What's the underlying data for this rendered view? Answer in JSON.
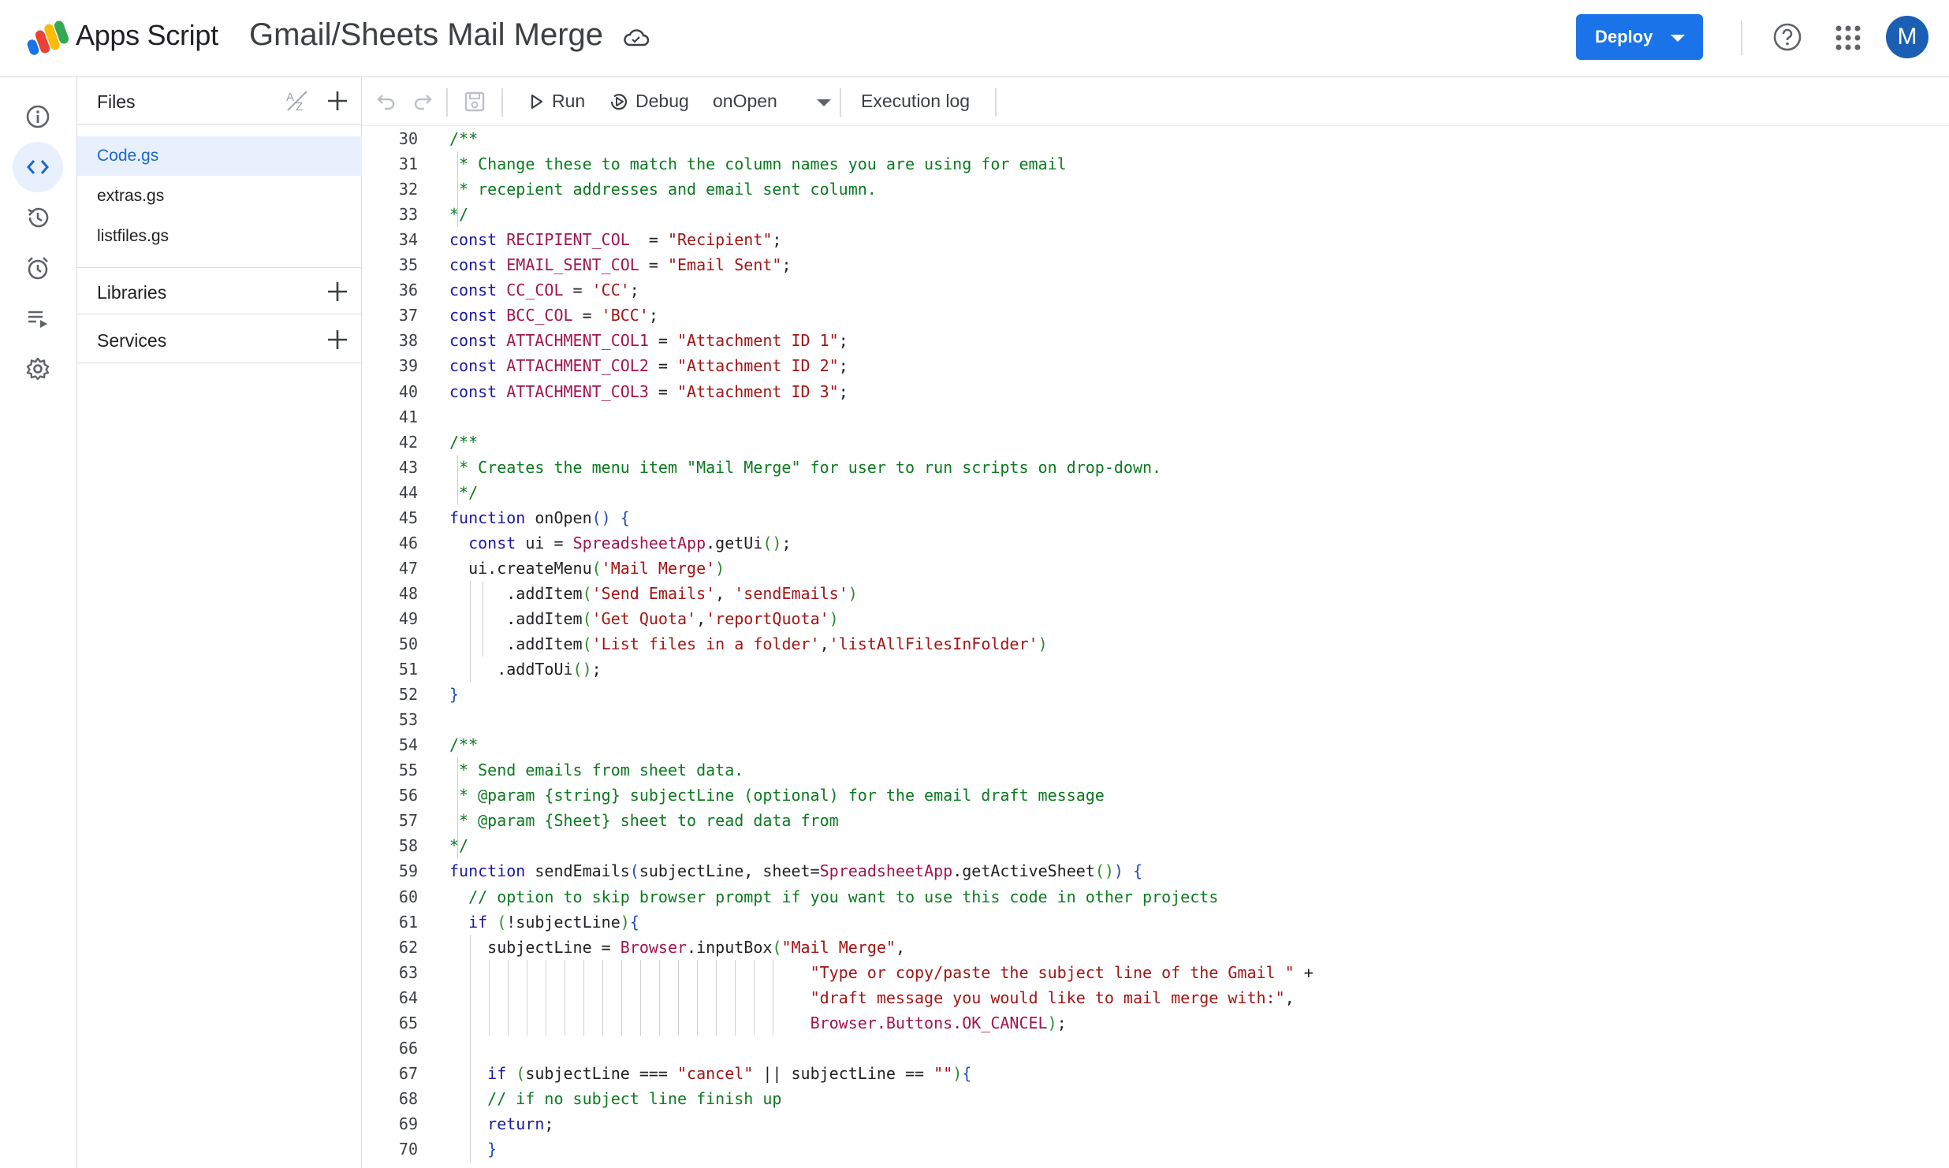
{
  "app": {
    "name": "Apps Script",
    "project_title": "Gmail/Sheets Mail Merge",
    "deploy_label": "Deploy",
    "avatar_letter": "M"
  },
  "rail": {
    "items": [
      {
        "name": "overview",
        "icon": "info-icon"
      },
      {
        "name": "editor",
        "icon": "code-icon",
        "active": true
      },
      {
        "name": "executions",
        "icon": "history-icon"
      },
      {
        "name": "triggers",
        "icon": "alarm-icon"
      },
      {
        "name": "executions-log",
        "icon": "list-play-icon"
      },
      {
        "name": "project-settings",
        "icon": "gear-icon"
      }
    ]
  },
  "files_panel": {
    "files_title": "Files",
    "files": [
      {
        "name": "Code.gs",
        "active": true
      },
      {
        "name": "extras.gs",
        "active": false
      },
      {
        "name": "listfiles.gs",
        "active": false
      }
    ],
    "libraries_title": "Libraries",
    "services_title": "Services"
  },
  "toolbar": {
    "run_label": "Run",
    "debug_label": "Debug",
    "function_selected": "onOpen",
    "execution_log_label": "Execution log"
  },
  "editor": {
    "lines": [
      {
        "n": "30",
        "tokens": [
          [
            "c",
            "/**"
          ]
        ]
      },
      {
        "n": "31",
        "tokens": [
          [
            "c",
            " * Change these to match the column names you are using for email"
          ]
        ]
      },
      {
        "n": "32",
        "tokens": [
          [
            "c",
            " * recepient addresses and email sent column."
          ]
        ]
      },
      {
        "n": "33",
        "tokens": [
          [
            "c",
            "*/"
          ]
        ]
      },
      {
        "n": "34",
        "tokens": [
          [
            "k",
            "const "
          ],
          [
            "v",
            "RECIPIENT_COL"
          ],
          [
            "p",
            "  = "
          ],
          [
            "s",
            "\"Recipient\""
          ],
          [
            "p",
            ";"
          ]
        ]
      },
      {
        "n": "35",
        "tokens": [
          [
            "k",
            "const "
          ],
          [
            "v",
            "EMAIL_SENT_COL"
          ],
          [
            "p",
            " = "
          ],
          [
            "s",
            "\"Email Sent\""
          ],
          [
            "p",
            ";"
          ]
        ]
      },
      {
        "n": "36",
        "tokens": [
          [
            "k",
            "const "
          ],
          [
            "v",
            "CC_COL"
          ],
          [
            "p",
            " = "
          ],
          [
            "s",
            "'CC'"
          ],
          [
            "p",
            ";"
          ]
        ]
      },
      {
        "n": "37",
        "tokens": [
          [
            "k",
            "const "
          ],
          [
            "v",
            "BCC_COL"
          ],
          [
            "p",
            " = "
          ],
          [
            "s",
            "'BCC'"
          ],
          [
            "p",
            ";"
          ]
        ]
      },
      {
        "n": "38",
        "tokens": [
          [
            "k",
            "const "
          ],
          [
            "v",
            "ATTACHMENT_COL1"
          ],
          [
            "p",
            " = "
          ],
          [
            "s",
            "\"Attachment ID 1\""
          ],
          [
            "p",
            ";"
          ]
        ]
      },
      {
        "n": "39",
        "tokens": [
          [
            "k",
            "const "
          ],
          [
            "v",
            "ATTACHMENT_COL2"
          ],
          [
            "p",
            " = "
          ],
          [
            "s",
            "\"Attachment ID 2\""
          ],
          [
            "p",
            ";"
          ]
        ]
      },
      {
        "n": "40",
        "tokens": [
          [
            "k",
            "const "
          ],
          [
            "v",
            "ATTACHMENT_COL3"
          ],
          [
            "p",
            " = "
          ],
          [
            "s",
            "\"Attachment ID 3\""
          ],
          [
            "p",
            ";"
          ]
        ]
      },
      {
        "n": "41",
        "tokens": []
      },
      {
        "n": "42",
        "tokens": [
          [
            "c",
            "/**"
          ]
        ]
      },
      {
        "n": "43",
        "tokens": [
          [
            "c",
            " * Creates the menu item \"Mail Merge\" for user to run scripts on drop-down."
          ]
        ]
      },
      {
        "n": "44",
        "tokens": [
          [
            "c",
            " */"
          ]
        ]
      },
      {
        "n": "45",
        "tokens": [
          [
            "k",
            "function "
          ],
          [
            "p",
            "onOpen"
          ],
          [
            "b",
            "() {"
          ]
        ]
      },
      {
        "n": "46",
        "tokens": [
          [
            "p",
            "  "
          ],
          [
            "k",
            "const "
          ],
          [
            "p",
            "ui = "
          ],
          [
            "v",
            "SpreadsheetApp"
          ],
          [
            "p",
            ".getUi"
          ],
          [
            "g",
            "()"
          ],
          [
            "p",
            ";"
          ]
        ]
      },
      {
        "n": "47",
        "tokens": [
          [
            "p",
            "  ui.createMenu"
          ],
          [
            "g",
            "("
          ],
          [
            "s",
            "'Mail Merge'"
          ],
          [
            "g",
            ")"
          ]
        ]
      },
      {
        "n": "48",
        "tokens": [
          [
            "p",
            "      .addItem"
          ],
          [
            "g",
            "("
          ],
          [
            "s",
            "'Send Emails'"
          ],
          [
            "p",
            ", "
          ],
          [
            "s",
            "'sendEmails'"
          ],
          [
            "g",
            ")"
          ]
        ]
      },
      {
        "n": "49",
        "tokens": [
          [
            "p",
            "      .addItem"
          ],
          [
            "g",
            "("
          ],
          [
            "s",
            "'Get Quota'"
          ],
          [
            "p",
            ","
          ],
          [
            "s",
            "'reportQuota'"
          ],
          [
            "g",
            ")"
          ]
        ]
      },
      {
        "n": "50",
        "tokens": [
          [
            "p",
            "      .addItem"
          ],
          [
            "g",
            "("
          ],
          [
            "s",
            "'List files in a folder'"
          ],
          [
            "p",
            ","
          ],
          [
            "s",
            "'listAllFilesInFolder'"
          ],
          [
            "g",
            ")"
          ]
        ]
      },
      {
        "n": "51",
        "tokens": [
          [
            "p",
            "     .addToUi"
          ],
          [
            "g",
            "()"
          ],
          [
            "p",
            ";"
          ]
        ]
      },
      {
        "n": "52",
        "tokens": [
          [
            "b",
            "}"
          ]
        ]
      },
      {
        "n": "53",
        "tokens": []
      },
      {
        "n": "54",
        "tokens": [
          [
            "c",
            "/**"
          ]
        ]
      },
      {
        "n": "55",
        "tokens": [
          [
            "c",
            " * Send emails from sheet data."
          ]
        ]
      },
      {
        "n": "56",
        "tokens": [
          [
            "c",
            " * @param {string} subjectLine (optional) for the email draft message"
          ]
        ]
      },
      {
        "n": "57",
        "tokens": [
          [
            "c",
            " * @param {Sheet} sheet to read data from"
          ]
        ]
      },
      {
        "n": "58",
        "tokens": [
          [
            "c",
            "*/"
          ]
        ]
      },
      {
        "n": "59",
        "tokens": [
          [
            "k",
            "function "
          ],
          [
            "p",
            "sendEmails"
          ],
          [
            "b",
            "("
          ],
          [
            "p",
            "subjectLine, sheet="
          ],
          [
            "v",
            "SpreadsheetApp"
          ],
          [
            "p",
            ".getActiveSheet"
          ],
          [
            "g",
            "()"
          ],
          [
            "b",
            ") {"
          ]
        ]
      },
      {
        "n": "60",
        "tokens": [
          [
            "p",
            "  "
          ],
          [
            "c",
            "// option to skip browser prompt if you want to use this code in other projects"
          ]
        ]
      },
      {
        "n": "61",
        "tokens": [
          [
            "p",
            "  "
          ],
          [
            "k",
            "if "
          ],
          [
            "g",
            "("
          ],
          [
            "p",
            "!subjectLine"
          ],
          [
            "g",
            ")"
          ],
          [
            "b",
            "{"
          ]
        ]
      },
      {
        "n": "62",
        "tokens": [
          [
            "p",
            "    subjectLine = "
          ],
          [
            "v",
            "Browser"
          ],
          [
            "p",
            ".inputBox"
          ],
          [
            "g",
            "("
          ],
          [
            "s",
            "\"Mail Merge\""
          ],
          [
            "p",
            ","
          ]
        ]
      },
      {
        "n": "63",
        "tokens": [
          [
            "p",
            "                                      "
          ],
          [
            "s",
            "\"Type or copy/paste the subject line of the Gmail \""
          ],
          [
            "p",
            " +"
          ]
        ]
      },
      {
        "n": "64",
        "tokens": [
          [
            "p",
            "                                      "
          ],
          [
            "s",
            "\"draft message you would like to mail merge with:\""
          ],
          [
            "p",
            ","
          ]
        ]
      },
      {
        "n": "65",
        "tokens": [
          [
            "p",
            "                                      "
          ],
          [
            "v",
            "Browser.Buttons.OK_CANCEL"
          ],
          [
            "g",
            ")"
          ],
          [
            "p",
            ";"
          ]
        ]
      },
      {
        "n": "66",
        "tokens": []
      },
      {
        "n": "67",
        "tokens": [
          [
            "p",
            "    "
          ],
          [
            "k",
            "if "
          ],
          [
            "g",
            "("
          ],
          [
            "p",
            "subjectLine === "
          ],
          [
            "s",
            "\"cancel\""
          ],
          [
            "p",
            " || subjectLine == "
          ],
          [
            "s",
            "\"\""
          ],
          [
            "g",
            ")"
          ],
          [
            "b",
            "{"
          ]
        ]
      },
      {
        "n": "68",
        "tokens": [
          [
            "p",
            "    "
          ],
          [
            "c",
            "// if no subject line finish up"
          ]
        ]
      },
      {
        "n": "69",
        "tokens": [
          [
            "p",
            "    "
          ],
          [
            "k",
            "return"
          ],
          [
            "p",
            ";"
          ]
        ]
      },
      {
        "n": "70",
        "tokens": [
          [
            "p",
            "    "
          ],
          [
            "b",
            "}"
          ]
        ]
      }
    ]
  }
}
